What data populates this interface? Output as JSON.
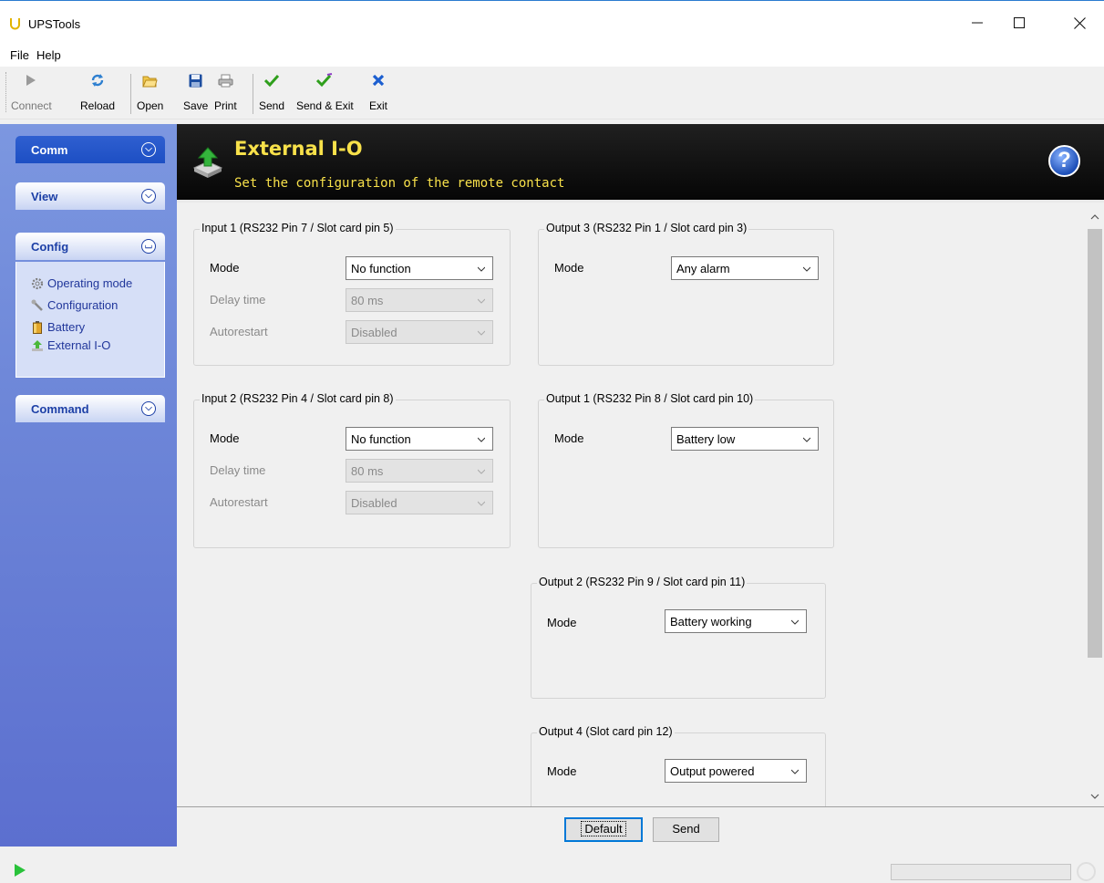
{
  "window": {
    "title": "UPSTools"
  },
  "menu": {
    "file": "File",
    "help": "Help"
  },
  "toolbar": {
    "connect": "Connect",
    "reload": "Reload",
    "open": "Open",
    "save": "Save",
    "print": "Print",
    "send": "Send",
    "send_exit": "Send & Exit",
    "exit": "Exit"
  },
  "sidebar": {
    "comm": "Comm",
    "view": "View",
    "config": "Config",
    "command": "Command",
    "items": [
      {
        "label": "Operating mode",
        "icon": "gear-icon"
      },
      {
        "label": "Configuration",
        "icon": "wrench-icon"
      },
      {
        "label": "Battery",
        "icon": "battery-icon"
      },
      {
        "label": "External I-O",
        "icon": "external-io-icon"
      }
    ]
  },
  "header": {
    "title": "External I-O",
    "subtitle": "Set the configuration of the remote contact"
  },
  "groups": {
    "input1": {
      "title": "Input 1 (RS232 Pin 7 / Slot card pin 5)",
      "mode_label": "Mode",
      "mode_value": "No function",
      "delay_label": "Delay time",
      "delay_value": "80 ms",
      "autorestart_label": "Autorestart",
      "autorestart_value": "Disabled"
    },
    "input2": {
      "title": "Input 2 (RS232 Pin 4 / Slot card pin 8)",
      "mode_label": "Mode",
      "mode_value": "No function",
      "delay_label": "Delay time",
      "delay_value": "80 ms",
      "autorestart_label": "Autorestart",
      "autorestart_value": "Disabled"
    },
    "output3": {
      "title": "Output 3 (RS232 Pin 1 / Slot card pin 3)",
      "mode_label": "Mode",
      "mode_value": "Any alarm"
    },
    "output1": {
      "title": "Output 1 (RS232 Pin 8 / Slot card pin 10)",
      "mode_label": "Mode",
      "mode_value": "Battery low"
    },
    "output2": {
      "title": "Output 2 (RS232 Pin 9 / Slot card pin 11)",
      "mode_label": "Mode",
      "mode_value": "Battery working"
    },
    "output4": {
      "title": "Output 4 (Slot card pin 12)",
      "mode_label": "Mode",
      "mode_value": "Output powered"
    }
  },
  "buttons": {
    "default": "Default",
    "send": "Send"
  },
  "colors": {
    "header_text": "#f8e14a",
    "sidebar": "#6d86d8",
    "panel_active": "#1d4fc4"
  }
}
